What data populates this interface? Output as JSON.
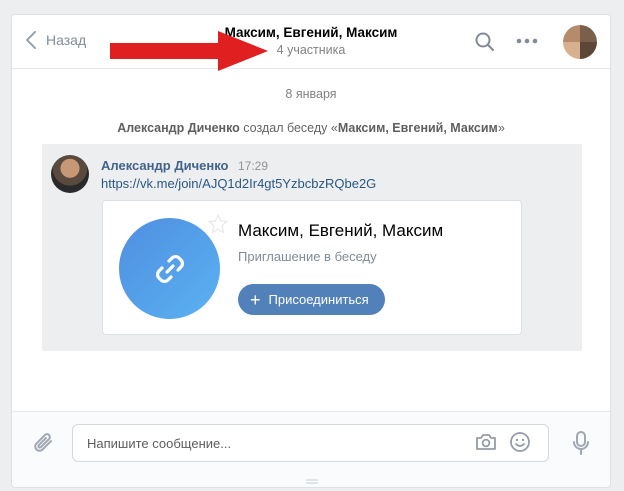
{
  "header": {
    "back_label": "Назад",
    "title": "Максим, Евгений, Максим",
    "subtitle": "4 участника"
  },
  "feed": {
    "date": "8 января",
    "service": {
      "actor": "Александр Диченко",
      "text": " создал беседу «",
      "chat_name": "Максим, Евгений, Максим",
      "end": "»"
    },
    "message": {
      "author": "Александр Диченко",
      "time": "17:29",
      "link": "https://vk.me/join/AJQ1d2Ir4gt5YzbcbzRQbe2G",
      "card": {
        "title": "Максим, Евгений, Максим",
        "subtitle": "Приглашение в беседу",
        "button_label": "Присоединиться",
        "button_icon": "+"
      }
    }
  },
  "composer": {
    "placeholder": "Напишите сообщение...",
    "value": ""
  },
  "colors": {
    "accent": "#5181b8",
    "link": "#2a5885",
    "annotation_arrow": "#e02020"
  },
  "icons": [
    "back-chevron-icon",
    "search-icon",
    "more-icon",
    "link-icon",
    "paperclip-icon",
    "camera-icon",
    "smile-icon",
    "microphone-icon"
  ]
}
